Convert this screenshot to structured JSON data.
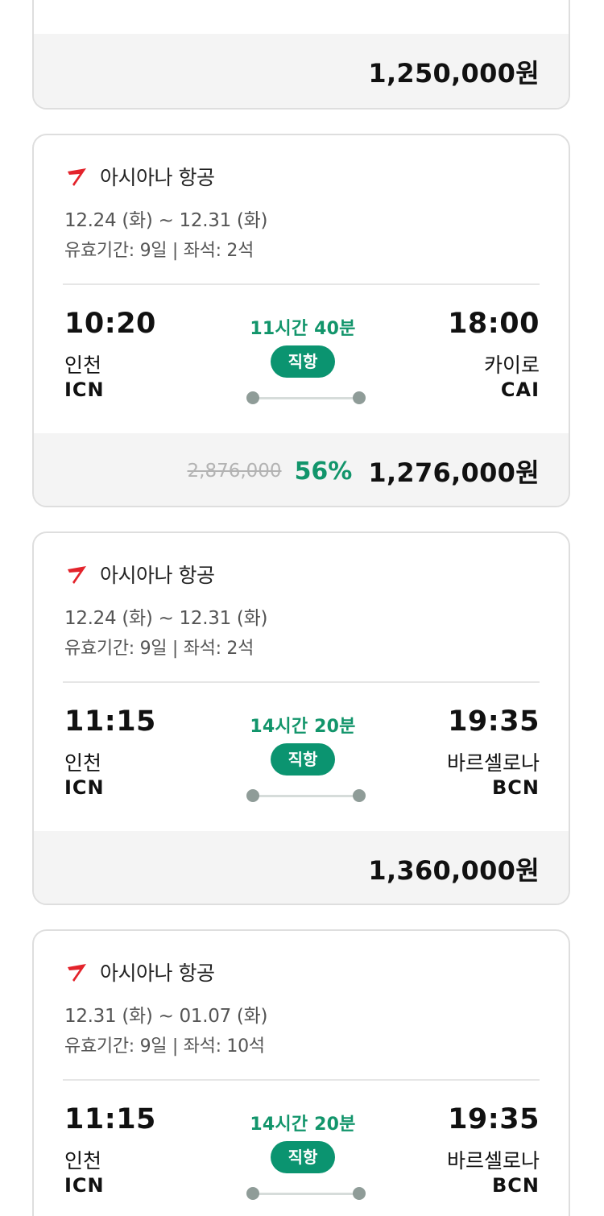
{
  "colors": {
    "accent_green": "#12956b",
    "badge_green": "#0b9470",
    "airline_red": "#e3232b",
    "card_border": "#dedede",
    "price_bar_bg": "#f4f4f4"
  },
  "partial_card": {
    "price": "1,250,000원"
  },
  "flights": [
    {
      "airline": "아시아나 항공",
      "airline_icon": "asiana-logo-icon",
      "dates": "12.24 (화) ~ 12.31 (화)",
      "validity": "유효기간: 9일 | 좌석: 2석",
      "departure_time": "10:20",
      "departure_city": "인천",
      "departure_code": "ICN",
      "duration": "11시간 40분",
      "direct_label": "직항",
      "arrival_time": "18:00",
      "arrival_city": "카이로",
      "arrival_code": "CAI",
      "original_price": "2,876,000",
      "discount": "56%",
      "price": "1,276,000원"
    },
    {
      "airline": "아시아나 항공",
      "airline_icon": "asiana-logo-icon",
      "dates": "12.24 (화) ~ 12.31 (화)",
      "validity": "유효기간: 9일 | 좌석: 2석",
      "departure_time": "11:15",
      "departure_city": "인천",
      "departure_code": "ICN",
      "duration": "14시간 20분",
      "direct_label": "직항",
      "arrival_time": "19:35",
      "arrival_city": "바르셀로나",
      "arrival_code": "BCN",
      "price": "1,360,000원"
    },
    {
      "airline": "아시아나 항공",
      "airline_icon": "asiana-logo-icon",
      "dates": "12.31 (화) ~ 01.07 (화)",
      "validity": "유효기간: 9일 | 좌석: 10석",
      "departure_time": "11:15",
      "departure_city": "인천",
      "departure_code": "ICN",
      "duration": "14시간 20분",
      "direct_label": "직항",
      "arrival_time": "19:35",
      "arrival_city": "바르셀로나",
      "arrival_code": "BCN"
    }
  ]
}
